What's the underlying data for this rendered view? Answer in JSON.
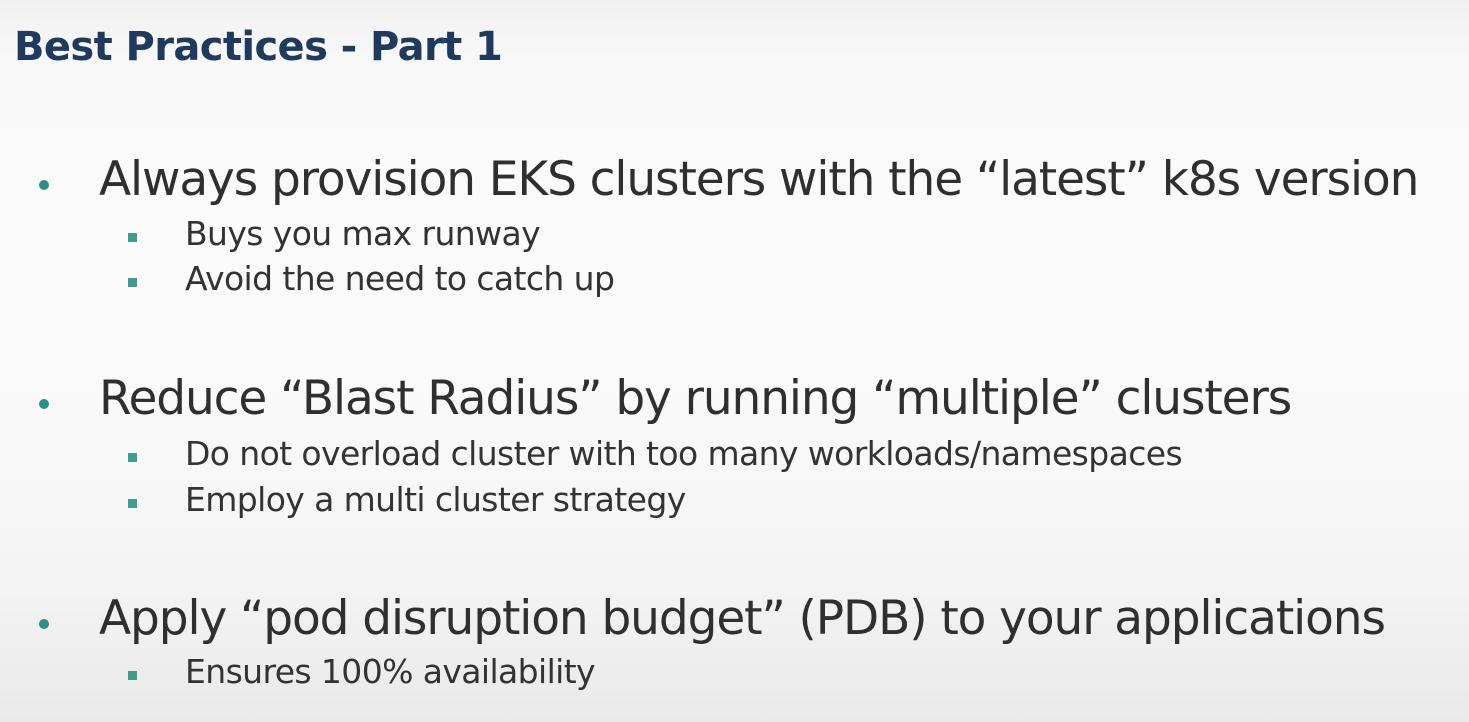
{
  "slide": {
    "title": "Best Practices - Part 1",
    "bullets": [
      {
        "text": "Always provision EKS clusters with the “latest” k8s version",
        "subs": [
          "Buys you max runway",
          "Avoid the need to catch up"
        ]
      },
      {
        "text": "Reduce “Blast Radius” by running “multiple” clusters",
        "subs": [
          "Do not overload cluster with too many workloads/namespaces",
          "Employ a multi cluster strategy"
        ]
      },
      {
        "text": "Apply “pod disruption budget” (PDB) to your applications",
        "subs": [
          "Ensures 100% availability"
        ]
      }
    ]
  },
  "colors": {
    "title": "#1f3a5c",
    "bullet_marker": "#2e8f84",
    "sub_marker": "#3f9c8f",
    "body_text": "#2f2f2f"
  }
}
